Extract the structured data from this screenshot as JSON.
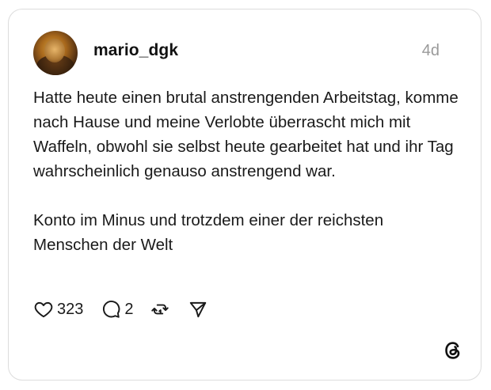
{
  "post": {
    "username": "mario_dgk",
    "timestamp": "4d",
    "paragraphs": [
      "Hatte heute einen brutal anstrengenden Arbeitstag, komme nach Hause und meine Verlobte überrascht mich mit Waffeln, obwohl sie selbst heute gearbeitet hat und ihr Tag wahrscheinlich genauso anstrengend war.",
      "Konto im Minus und trotzdem einer der reichsten Menschen der Welt"
    ],
    "likes": "323",
    "replies": "2"
  },
  "icons": {
    "like": "heart-icon",
    "reply": "comment-icon",
    "repost": "repost-icon",
    "share": "send-icon",
    "brand": "threads-logo-icon"
  }
}
